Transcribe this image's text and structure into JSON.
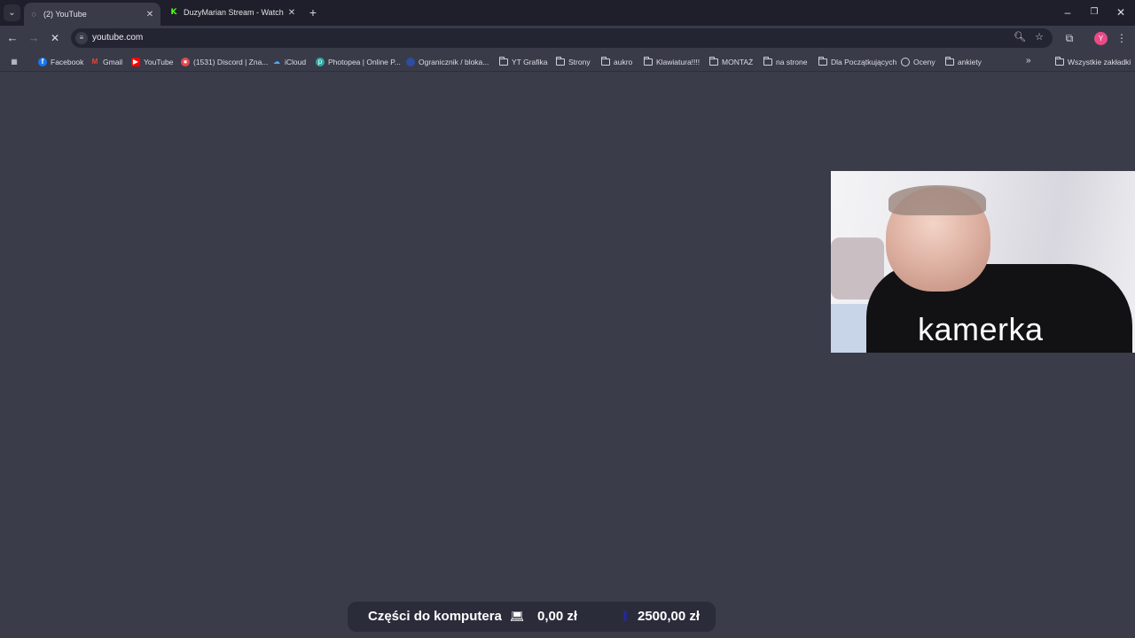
{
  "tabs": [
    {
      "title": "(2) YouTube",
      "favicon": "loading-icon",
      "active": true
    },
    {
      "title": "DuzyMarian Stream - Watch Live",
      "favicon": "kick-icon",
      "active": false
    }
  ],
  "omnibox": {
    "url": "youtube.com"
  },
  "profile": {
    "initial": "Y",
    "color": "#e94b87"
  },
  "bookmarks": [
    {
      "label": "Facebook",
      "icon": "facebook-icon"
    },
    {
      "label": "Gmail",
      "icon": "gmail-icon"
    },
    {
      "label": "YouTube",
      "icon": "youtube-icon"
    },
    {
      "label": "(1531) Discord | Zna...",
      "icon": "discord-icon"
    },
    {
      "label": "iCloud",
      "icon": "icloud-icon"
    },
    {
      "label": "Photopea | Online P...",
      "icon": "photopea-icon"
    },
    {
      "label": "Ogranicznik / bloka...",
      "icon": "site-icon"
    },
    {
      "label": "YT Grafika",
      "icon": "folder-icon"
    },
    {
      "label": "Strony",
      "icon": "folder-icon"
    },
    {
      "label": "aukro",
      "icon": "folder-icon"
    },
    {
      "label": "Klawiatura!!!!",
      "icon": "folder-icon"
    },
    {
      "label": "MONTAŻ",
      "icon": "folder-icon"
    },
    {
      "label": "na strone",
      "icon": "folder-icon"
    },
    {
      "label": "Dla Początkujących",
      "icon": "folder-icon"
    },
    {
      "label": "Oceny",
      "icon": "globe-icon"
    },
    {
      "label": "ankiety",
      "icon": "folder-icon"
    }
  ],
  "all_bookmarks_label": "Wszystkie zakładki",
  "camera": {
    "label": "kamerka"
  },
  "donation_goal": {
    "label": "Części do komputera",
    "icon": "laptop-icon",
    "current": "0,00 zł",
    "target": "2500,00 zł"
  },
  "colors": {
    "page_background": "#3a3c4a",
    "tab_strip": "#1e1f2b",
    "kick_green": "#53fc18"
  }
}
